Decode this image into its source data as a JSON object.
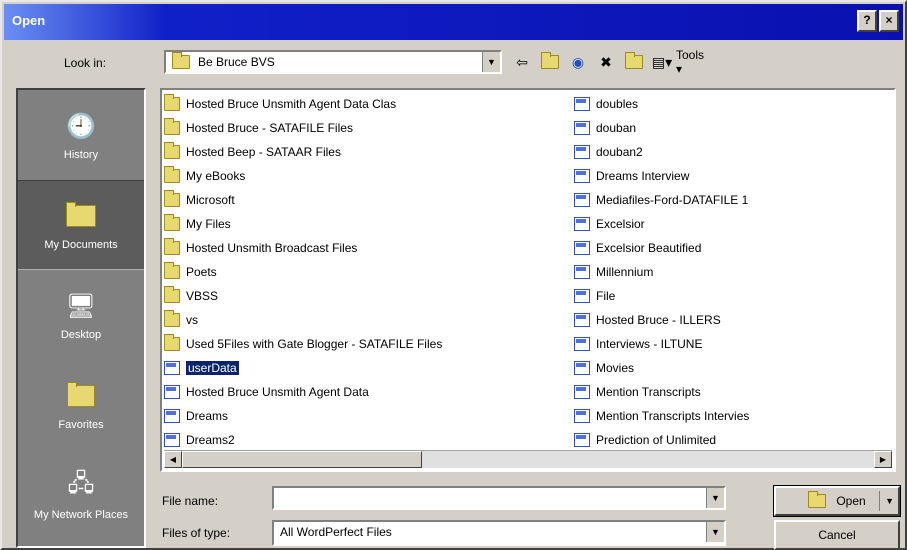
{
  "window": {
    "title": "Open",
    "minimize_label": "?",
    "close_label": "×"
  },
  "toolbar": {
    "lookin_label": "Look in:",
    "lookin_value": "Be Bruce BVS",
    "tools_label": "Tools ▾",
    "icons": [
      "back-icon",
      "up-folder-icon",
      "search-web-icon",
      "delete-icon",
      "new-folder-icon",
      "views-icon"
    ]
  },
  "places": [
    {
      "label": "History",
      "icon": "history-icon"
    },
    {
      "label": "My Documents",
      "icon": "my-documents-icon"
    },
    {
      "label": "Desktop",
      "icon": "desktop-icon"
    },
    {
      "label": "Favorites",
      "icon": "favorites-icon"
    },
    {
      "label": "My Network Places",
      "icon": "network-icon"
    }
  ],
  "files": {
    "column1": [
      {
        "name": "Hosted Bruce Unsmith Agent Data Clas",
        "type": "folder"
      },
      {
        "name": "Hosted Bruce - SATAFILE Files",
        "type": "folder"
      },
      {
        "name": "Hosted Beep - SATAAR Files",
        "type": "folder"
      },
      {
        "name": "My eBooks",
        "type": "folder"
      },
      {
        "name": "Microsoft",
        "type": "folder"
      },
      {
        "name": "My Files",
        "type": "folder"
      },
      {
        "name": "Hosted Unsmith Broadcast Files",
        "type": "folder"
      },
      {
        "name": "Poets",
        "type": "folder"
      },
      {
        "name": "VBSS",
        "type": "folder"
      },
      {
        "name": "vs",
        "type": "folder"
      },
      {
        "name": "Used 5Files with Gate Blogger - SATAFILE Files",
        "type": "folder"
      },
      {
        "name": "userData",
        "type": "doc",
        "selected": true
      },
      {
        "name": "Hosted Bruce Unsmith Agent Data",
        "type": "doc"
      },
      {
        "name": "Dreams",
        "type": "doc"
      },
      {
        "name": "Dreams2",
        "type": "doc"
      }
    ],
    "column2": [
      {
        "name": "doubles",
        "type": "doc"
      },
      {
        "name": "douban",
        "type": "doc"
      },
      {
        "name": "douban2",
        "type": "doc"
      },
      {
        "name": "Dreams Interview",
        "type": "doc"
      },
      {
        "name": "Mediafiles-Ford-DATAFILE 1",
        "type": "doc"
      },
      {
        "name": "Excelsior",
        "type": "doc"
      },
      {
        "name": "Excelsior Beautified",
        "type": "doc"
      },
      {
        "name": "Millennium",
        "type": "doc"
      },
      {
        "name": "File",
        "type": "doc"
      },
      {
        "name": "Hosted Bruce - ILLERS",
        "type": "doc"
      },
      {
        "name": "Interviews - ILTUNE",
        "type": "doc"
      },
      {
        "name": "Movies",
        "type": "doc"
      },
      {
        "name": "Mention Transcripts",
        "type": "doc"
      },
      {
        "name": "Mention Transcripts Intervies",
        "type": "doc"
      },
      {
        "name": "Prediction of Unlimited",
        "type": "doc"
      }
    ]
  },
  "bottom": {
    "filename_label": "File name:",
    "filename_value": "",
    "filetype_label": "Files of type:",
    "filetype_value": "All WordPerfect Files",
    "open_label": "Open",
    "cancel_label": "Cancel"
  }
}
